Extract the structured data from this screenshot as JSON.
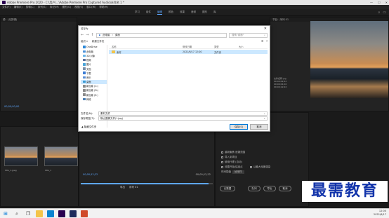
{
  "app": {
    "title": "Adobe Premiere Pro 2020 - C:\\用户\\...\\Adobe Premiere Pro Captured Audio\\未命名 1 *",
    "menus": [
      "文件(F)",
      "编辑(E)",
      "剪辑(C)",
      "序列(S)",
      "标记(M)",
      "图形(G)",
      "视图(V)",
      "窗口(W)",
      "帮助(H)"
    ],
    "workspaces": [
      "学习",
      "组件",
      "编辑",
      "颜色",
      "效果",
      "音频",
      "图形",
      "库"
    ],
    "active_workspace": "编辑"
  },
  "source_monitor": {
    "header": "源：(无剪辑)",
    "timecode": "00;00;00;00"
  },
  "program_monitor": {
    "header": "节目：序列 01",
    "info_lines": [
      "文件名称.jpg",
      "00;00;02;22",
      "00;00;01;02",
      "00;00;12;22"
    ]
  },
  "project_panel": {
    "clips": [
      {
        "label": "IMG_1.jpeg"
      },
      {
        "label": "IMG_1"
      }
    ]
  },
  "timeline": {
    "timecode_start": "00;00;12;22",
    "timecode_end": "00;00;12;22",
    "progress": 0.97,
    "bottom_labels": [
      "导出",
      "序列 01"
    ]
  },
  "effects_panel": {
    "rows": [
      "重新聚焦 遮罩范围",
      "导入到项目",
      "使用代理 (自动)",
      "设置开始/结束点"
    ],
    "dropdown_label": "时间插值",
    "dropdown_value": "帧采样",
    "render_label": "以最大深度渲染",
    "buttons": [
      "元数据",
      "队列",
      "导出",
      "取消"
    ]
  },
  "dialog": {
    "title": "另存为",
    "path": [
      "此电脑",
      "桌面"
    ],
    "search_placeholder": "搜索\"桌面\"",
    "organize": "组织 ▾",
    "new_folder": "新建文件夹",
    "nav_items": [
      {
        "label": "OneDrive",
        "icon": "onedrive-icon"
      },
      {
        "label": "此电脑",
        "icon": "pc-icon"
      },
      {
        "label": "3D 对象",
        "icon": "3d-objects-icon"
      },
      {
        "label": "视频",
        "icon": "videos-icon"
      },
      {
        "label": "图片",
        "icon": "pictures-icon"
      },
      {
        "label": "文档",
        "icon": "documents-icon"
      },
      {
        "label": "下载",
        "icon": "downloads-icon"
      },
      {
        "label": "音乐",
        "icon": "music-icon"
      },
      {
        "label": "桌面",
        "icon": "desktop-icon"
      },
      {
        "label": "新加卷 (C:)",
        "icon": "drive-icon"
      },
      {
        "label": "新加卷 (D:)",
        "icon": "drive-icon"
      },
      {
        "label": "新加卷 (E:)",
        "icon": "drive-icon"
      },
      {
        "label": "网络",
        "icon": "network-icon"
      }
    ],
    "selected_nav": "桌面",
    "columns": [
      "名称",
      "修改日期",
      "类型",
      "大小"
    ],
    "files": [
      {
        "name": "素材",
        "date": "2021/6/17 12:00",
        "type": "文件夹",
        "size": ""
      }
    ],
    "filename_label": "文件名(N):",
    "filename_value": "素材文件",
    "filetype_label": "保存类型(T):",
    "filetype_value": "静止图像文件(*.jpg)",
    "hide_folders": "▲ 隐藏文件夹",
    "save_button": "保存(S)",
    "cancel_button": "取消"
  },
  "watermark": "最需教育",
  "taskbar": {
    "time": "12:00",
    "date": "2021/6/17"
  }
}
